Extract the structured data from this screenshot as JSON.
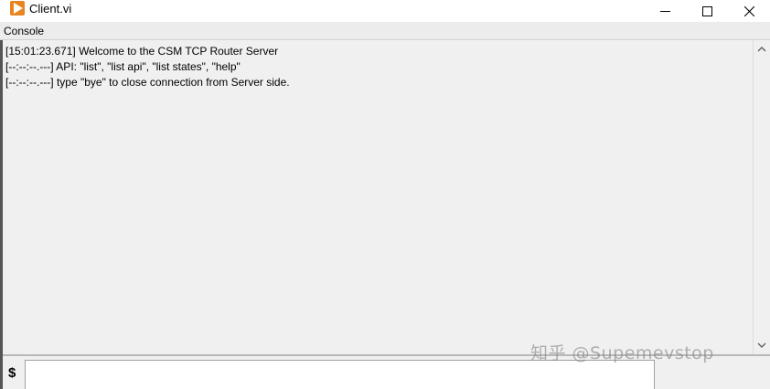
{
  "window": {
    "title": "Client.vi",
    "icons": [
      "labview-play-icon",
      "minimize-icon",
      "maximize-icon",
      "close-icon"
    ]
  },
  "panel": {
    "label": "Console"
  },
  "console": {
    "lines": [
      "[15:01:23.671] Welcome to the CSM TCP Router Server",
      "[--:--:--.---] API: \"list\", \"list api\", \"list states\", \"help\"",
      "[--:--:--.---] type \"bye\" to close connection from Server side."
    ]
  },
  "input": {
    "prompt_symbol": "$",
    "value": ""
  },
  "watermark": {
    "text": "知乎 @Supemevstop"
  },
  "colors": {
    "app_icon": "#e8851e",
    "background": "#f0f0f0"
  }
}
